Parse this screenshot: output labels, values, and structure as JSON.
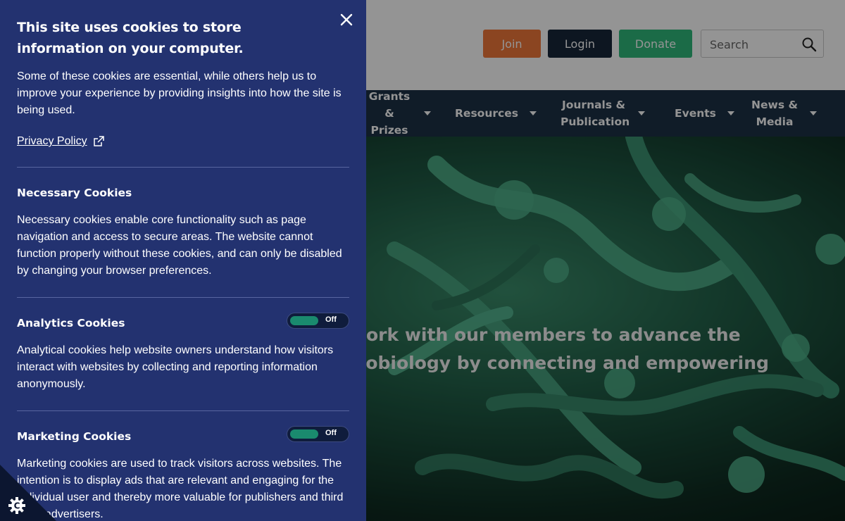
{
  "header": {
    "join_label": "Join",
    "login_label": "Login",
    "donate_label": "Donate",
    "search_placeholder": "Search"
  },
  "nav": {
    "items": [
      {
        "label": "Grants &\nPrizes"
      },
      {
        "label": "Resources"
      },
      {
        "label": "Journals &\nPublication"
      },
      {
        "label": "Events"
      },
      {
        "label": "News &\nMedia"
      }
    ]
  },
  "hero": {
    "line1": "ork with our members to advance the",
    "line2": "robiology by connecting and empowering"
  },
  "cookie_panel": {
    "title": "This site uses cookies to store information on your computer.",
    "intro": "Some of these cookies are essential, while others help us to improve your experience by providing insights into how the site is being used.",
    "privacy_label": "Privacy Policy",
    "sections": [
      {
        "title": "Necessary Cookies",
        "text": "Necessary cookies enable core functionality such as page navigation and access to secure areas. The website cannot function properly without these cookies, and can only be disabled by changing your browser preferences."
      },
      {
        "title": "Analytics Cookies",
        "toggle_state": "Off",
        "text": "Analytical cookies help website owners understand how visitors interact with websites by collecting and reporting information anonymously."
      },
      {
        "title": "Marketing Cookies",
        "toggle_state": "Off",
        "text": "Marketing cookies are used to track visitors across websites. The intention is to display ads that are relevant and engaging for the individual user and thereby more valuable for publishers and third party advertisers."
      }
    ]
  },
  "colors": {
    "panel_bg": "#233270",
    "join": "#f0773a",
    "login": "#17263a",
    "donate": "#2fb87a",
    "nav_bg": "#1d3146",
    "toggle_on": "#1a8a6e"
  },
  "icons": [
    "close-icon",
    "external-link-icon",
    "search-icon",
    "chevron-down-icon",
    "cookie-gear-icon"
  ]
}
